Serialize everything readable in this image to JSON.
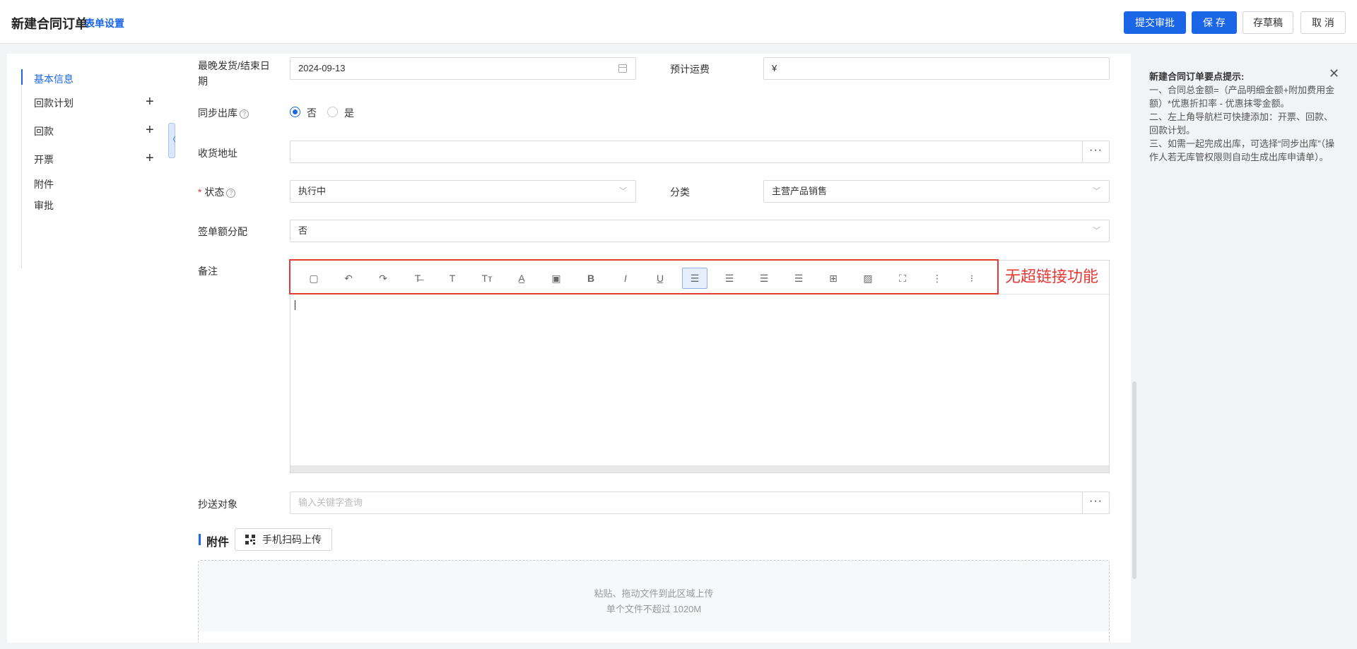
{
  "header": {
    "title": "新建合同订单",
    "form_settings": "表单设置",
    "buttons": {
      "submit_approval": "提交审批",
      "save": "保 存",
      "save_draft": "存草稿",
      "cancel": "取 消"
    }
  },
  "nav": {
    "items": [
      {
        "label": "基本信息"
      },
      {
        "label": "回款计划"
      },
      {
        "label": "回款"
      },
      {
        "label": "开票"
      },
      {
        "label": "附件"
      },
      {
        "label": "审批"
      }
    ],
    "plus": "+",
    "collapse": "〈"
  },
  "form": {
    "latest_date": {
      "label": "最晚发货/结束日期",
      "value": "2024-09-13"
    },
    "freight": {
      "label": "预计运费",
      "prefix": "¥"
    },
    "sync_outbound": {
      "label": "同步出库",
      "help": "?",
      "options": [
        "否",
        "是"
      ],
      "selected": "否"
    },
    "address": {
      "label": "收货地址",
      "more": "···"
    },
    "status": {
      "required": "*",
      "label": "状态",
      "help": "?",
      "value": "执行中"
    },
    "category": {
      "label": "分类",
      "value": "主营产品销售"
    },
    "amount_split": {
      "label": "签单额分配",
      "value": "否"
    },
    "remarks": {
      "label": "备注"
    },
    "cc": {
      "label": "抄送对象",
      "placeholder": "输入关键字查询",
      "more": "···"
    },
    "chevron": "﹀"
  },
  "editor": {
    "tools": {
      "template": "▢",
      "undo": "↶",
      "redo": "↷",
      "strikethrough": "T̶",
      "heading": "T",
      "font_size": "Tт",
      "font_color": "A̲",
      "background_color": "▣",
      "bold": "B",
      "italic": "I",
      "underline": "U̲",
      "align_left": "☰",
      "align_center": "☰",
      "align_right": "☰",
      "justify": "☰",
      "table": "⊞",
      "image": "▨",
      "fullscreen": "⛶",
      "ordered_list": "⋮",
      "bullet_list": "⁝"
    },
    "annotation": "无超链接功能"
  },
  "attachments": {
    "title": "附件",
    "qr_button": "手机扫码上传",
    "dropzone_line1": "粘贴、拖动文件到此区域上传",
    "dropzone_line2": "单个文件不超过 1020M"
  },
  "tips": {
    "title": "新建合同订单要点提示:",
    "close": "✕",
    "lines": [
      "一、合同总金额=（产品明细金额+附加费用金额）*优惠折扣率 - 优惠抹零金额。",
      "二、左上角导航栏可快捷添加：开票、回款、回款计划。",
      "三、如需一起完成出库，可选择“同步出库”（操作人若无库管权限则自动生成出库申请单）。"
    ]
  },
  "colors": {
    "primary": "#1a66e6",
    "annotation_red": "#e53935"
  }
}
